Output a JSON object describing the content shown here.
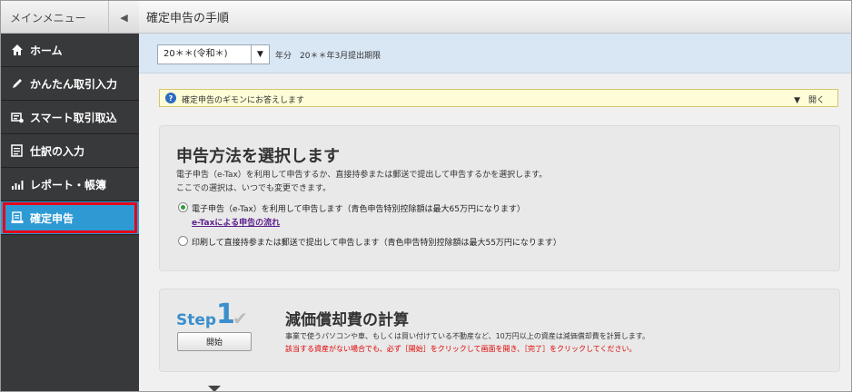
{
  "sidebar": {
    "header_title": "メインメニュー",
    "collapse_icon": "chevron-left-icon",
    "items": [
      {
        "label": "ホーム",
        "icon": "home-icon"
      },
      {
        "label": "かんたん取引入力",
        "icon": "pencil-icon"
      },
      {
        "label": "スマート取引取込",
        "icon": "import-icon"
      },
      {
        "label": "仕訳の入力",
        "icon": "journal-icon"
      },
      {
        "label": "レポート・帳簿",
        "icon": "report-chart-icon"
      },
      {
        "label": "確定申告",
        "icon": "tax-return-icon",
        "active": true
      }
    ]
  },
  "main": {
    "title": "確定申告の手順",
    "year_select": {
      "value": "20＊＊(令和＊)"
    },
    "year_label": "年分　20＊＊年3月提出期限",
    "faq": {
      "text": "確定申告のギモンにお答えします",
      "toggle": "開く"
    },
    "method": {
      "heading": "申告方法を選択します",
      "desc1": "電子申告（e-Tax）を利用して申告するか、直接持参または郵送で提出して申告するかを選択します。",
      "desc2": "ここでの選択は、いつでも変更できます。",
      "option1": "電子申告（e-Tax）を利用して申告します（青色申告特別控除額は最大65万円になります）",
      "option1_link": "e-Taxによる申告の流れ",
      "option2": "印刷して直接持参または郵送で提出して申告します（青色申告特別控除額は最大55万円になります）",
      "selected": 1
    },
    "step1": {
      "step_word": "Step",
      "step_num": "1",
      "button": "開始",
      "title": "減価償却費の計算",
      "desc": "事業で使うパソコンや車、もしくは買い付けている不動産など、10万円以上の資産は減価償却費を計算します。",
      "note": "該当する資産がない場合でも、必ず［開始］をクリックして画面を開き、［完了］をクリックしてください。"
    }
  },
  "colors": {
    "accent": "#2e9ad4",
    "highlight_border": "#e6001a",
    "sidebar_bg": "#38393b"
  }
}
